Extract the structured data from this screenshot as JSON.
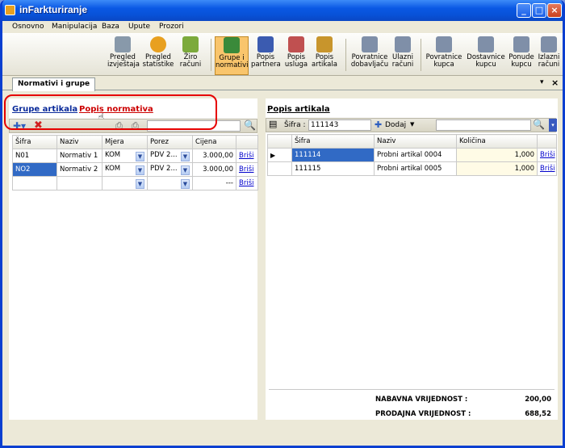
{
  "window": {
    "title": "inFarkturiranje"
  },
  "menu": [
    "Osnovno",
    "Manipulacija",
    "Baza",
    "Upute",
    "Prozori"
  ],
  "ribbon": [
    {
      "label": "Pregled izvještaja",
      "icon": "report-icon"
    },
    {
      "label": "Pregled statistike",
      "icon": "pie-chart-icon"
    },
    {
      "label": "Žiro računi",
      "icon": "bank-account-icon"
    },
    {
      "label": "Grupe i normativi",
      "icon": "groups-icon",
      "active": true
    },
    {
      "label": "Popis partnera",
      "icon": "partners-icon"
    },
    {
      "label": "Popis usluga",
      "icon": "services-icon"
    },
    {
      "label": "Popis artikala",
      "icon": "box-icon"
    },
    {
      "label": "Povratnice dobavljaču",
      "icon": "truck-icon"
    },
    {
      "label": "Ulazni računi",
      "icon": "truck-icon"
    },
    {
      "label": "Povratnice kupca",
      "icon": "truck-icon"
    },
    {
      "label": "Dostavnice kupcu",
      "icon": "truck-icon"
    },
    {
      "label": "Ponude kupcu",
      "icon": "truck-icon"
    },
    {
      "label": "Izlazni računi",
      "icon": "truck-icon"
    }
  ],
  "tab": {
    "label": "Normativi i grupe"
  },
  "left": {
    "link1": "Grupe artikala",
    "link2": "Popis normativa",
    "columns": [
      "Šifra",
      "Naziv",
      "Mjera",
      "Porez",
      "Cijena",
      ""
    ],
    "rows": [
      {
        "sifra": "N01",
        "naziv": "Normativ 1",
        "mjera": "KOM",
        "porez": "PDV 2...",
        "cijena": "3.000,00",
        "action": "Briši"
      },
      {
        "sifra": "NO2",
        "naziv": "Normativ 2",
        "mjera": "KOM",
        "porez": "PDV 2...",
        "cijena": "3.000,00",
        "action": "Briši"
      }
    ],
    "new_row_cijena": "---",
    "new_row_action": "Briši"
  },
  "right": {
    "title": "Popis artikala",
    "sifra_label": "Šifra :",
    "sifra_value": "111143",
    "add_label": "Dodaj",
    "columns": [
      "Šifra",
      "Naziv",
      "Količina",
      ""
    ],
    "rows": [
      {
        "sifra": "111114",
        "naziv": "Probni artikal 0004",
        "kolicina": "1,000",
        "action": "Briši"
      },
      {
        "sifra": "111115",
        "naziv": "Probni artikal 0005",
        "kolicina": "1,000",
        "action": "Briši"
      }
    ],
    "nabavna_label": "NABAVNA VRIJEDNOST :",
    "nabavna_value": "200,00",
    "prodajna_label": "PRODAJNA VRIJEDNOST :",
    "prodajna_value": "688,52"
  }
}
